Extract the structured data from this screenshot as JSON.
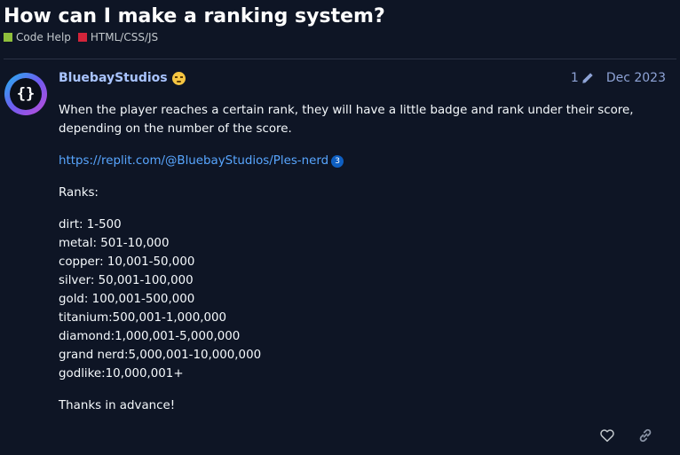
{
  "topic": {
    "title": "How can I make a ranking system?",
    "categories": [
      {
        "label": "Code Help",
        "color": "#8fbf3c"
      },
      {
        "label": "HTML/CSS/JS",
        "color": "#d3243a"
      }
    ]
  },
  "post": {
    "avatar_glyph": "{}",
    "username": "BluebayStudios",
    "user_emoji": "tired-face-emoji",
    "edit_count": "1",
    "date": "Dec 2023",
    "intro": "When the player reaches a certain rank, they will have a little badge and rank under their score, depending on the number of the score.",
    "link_text": "https://replit.com/@BluebayStudios/Ples-nerd",
    "link_clicks": "3",
    "ranks_heading": "Ranks:",
    "ranks": [
      "dirt: 1-500",
      "metal: 501-10,000",
      "copper: 10,001-50,000",
      "silver: 50,001-100,000",
      "gold: 100,001-500,000",
      "titanium:500,001-1,000,000",
      "diamond:1,000,001-5,000,000",
      "grand nerd:5,000,001-10,000,000",
      "godlike:10,000,001+"
    ],
    "closing": "Thanks in advance!"
  },
  "actions": {
    "like_icon": "heart-icon",
    "share_icon": "link-icon"
  }
}
